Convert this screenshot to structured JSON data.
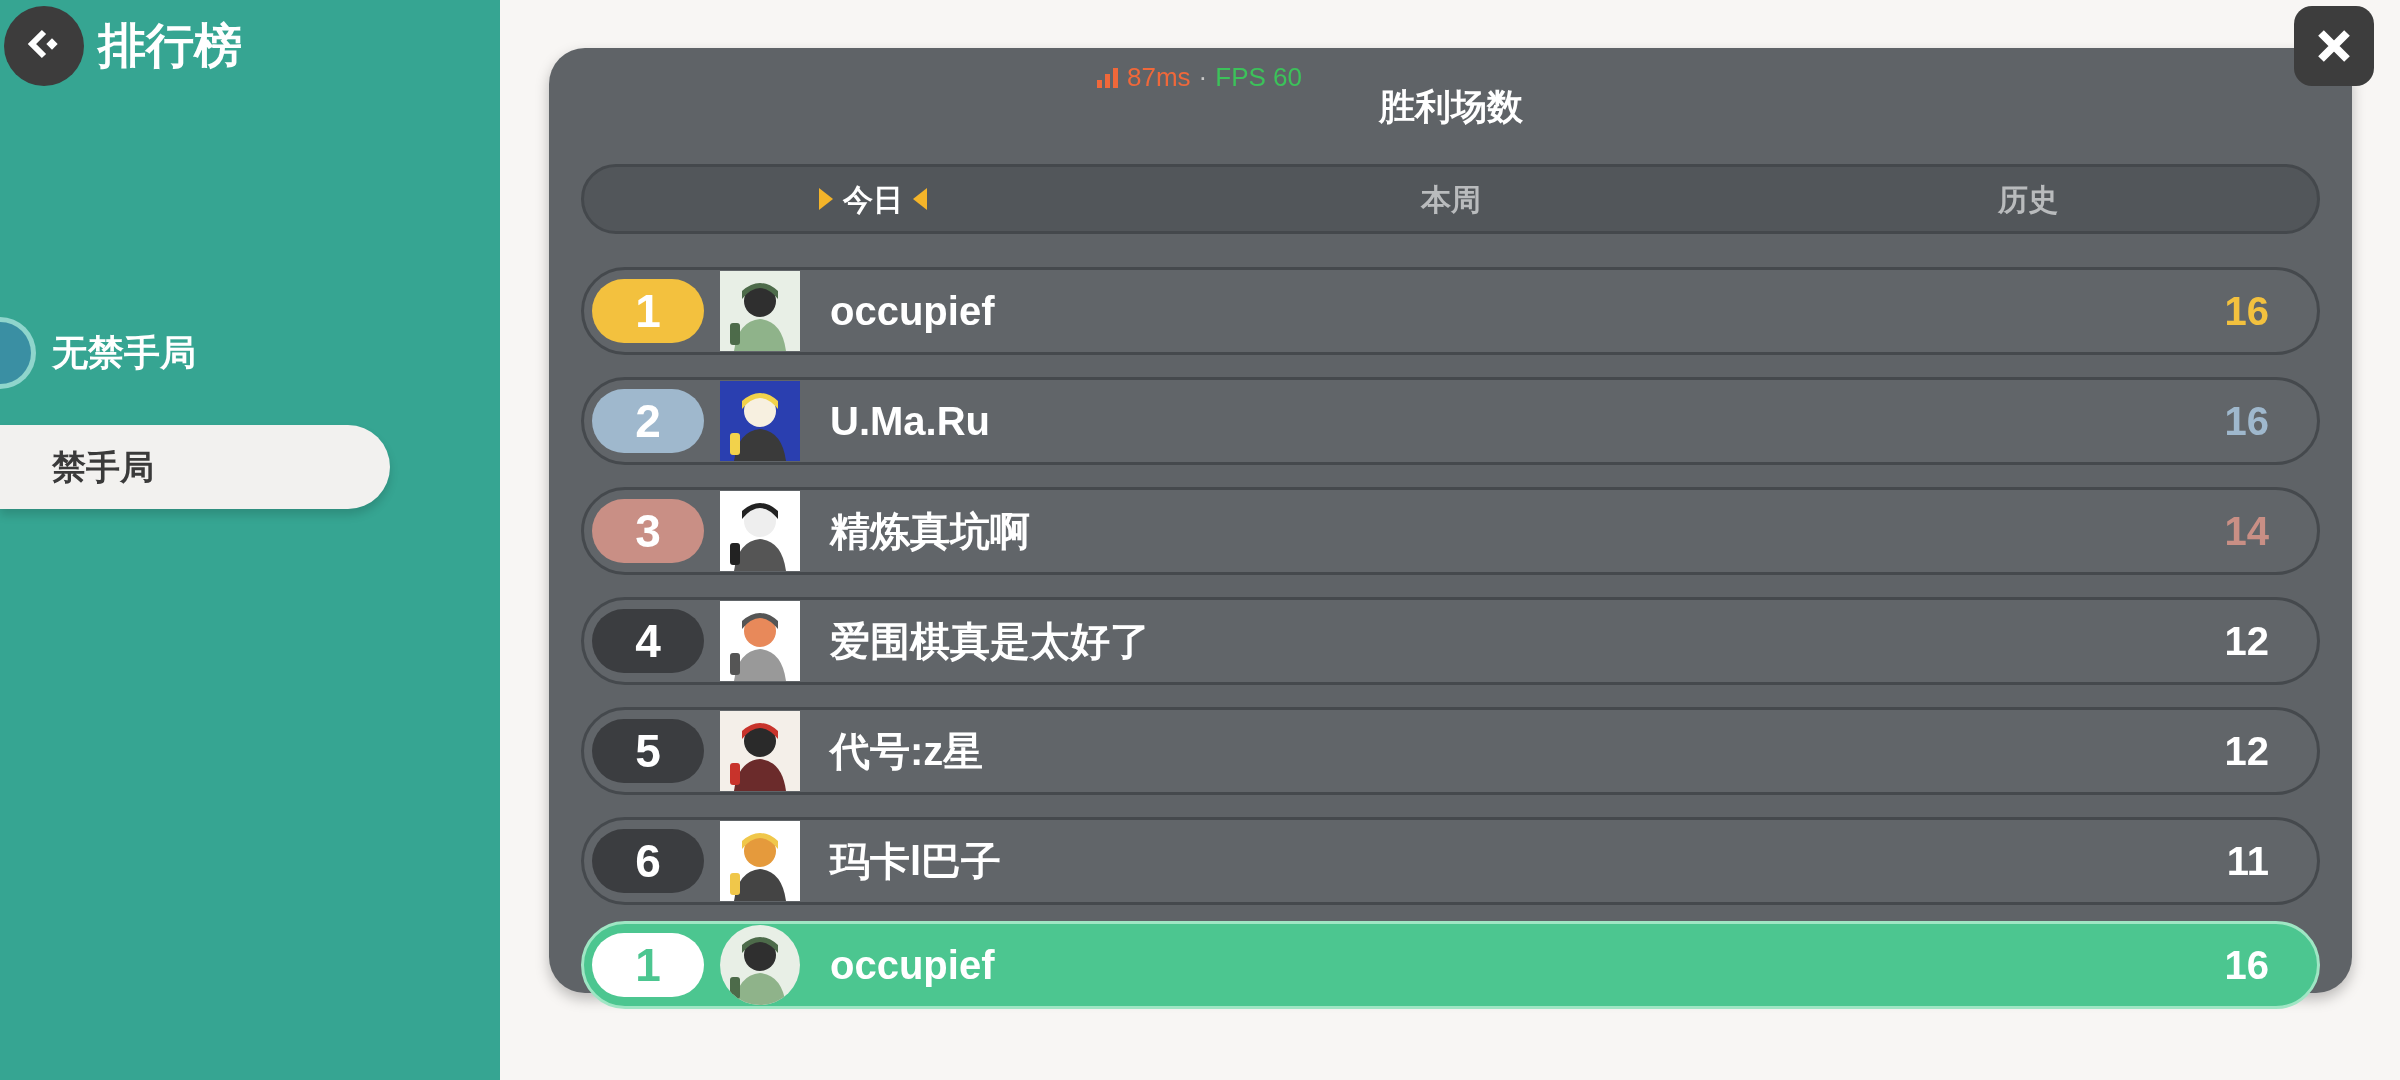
{
  "header": {
    "title": "排行榜"
  },
  "sidebar": {
    "items": [
      {
        "label": "无禁手局",
        "selected": false
      },
      {
        "label": "禁手局",
        "selected": true
      }
    ]
  },
  "perf": {
    "ping": "87ms",
    "separator": "·",
    "fps": "FPS 60"
  },
  "panel": {
    "title": "胜利场数",
    "tabs": [
      {
        "label": "今日",
        "selected": true
      },
      {
        "label": "本周",
        "selected": false
      },
      {
        "label": "历史",
        "selected": false
      }
    ],
    "rows": [
      {
        "rank": "1",
        "kind": "medal",
        "color": "#f3c13e",
        "name": "occupief",
        "score": "16"
      },
      {
        "rank": "2",
        "kind": "medal",
        "color": "#9fb8cd",
        "name": "U.Ma.Ru",
        "score": "16"
      },
      {
        "rank": "3",
        "kind": "medal",
        "color": "#c98f85",
        "name": "精炼真坑啊",
        "score": "14"
      },
      {
        "rank": "4",
        "kind": "plain",
        "color": "#3b3d40",
        "name": "爱围棋真是太好了",
        "score": "12"
      },
      {
        "rank": "5",
        "kind": "plain",
        "color": "#3b3d40",
        "name": "代号:z星",
        "score": "12"
      },
      {
        "rank": "6",
        "kind": "plain",
        "color": "#3b3d40",
        "name": "玛卡l巴子",
        "score": "11"
      }
    ],
    "own_row": {
      "rank": "1",
      "name": "occupief",
      "score": "16"
    }
  }
}
